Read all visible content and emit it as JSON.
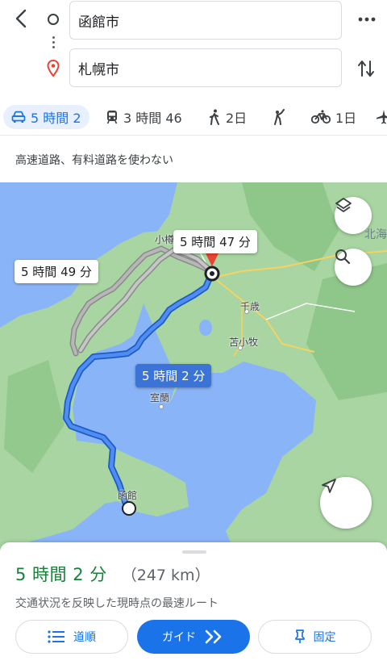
{
  "header": {
    "origin": "函館市",
    "destination": "札幌市"
  },
  "modes": [
    {
      "icon": "car-icon",
      "label": "5 時間 2",
      "active": true
    },
    {
      "icon": "train-icon",
      "label": "3 時間 46"
    },
    {
      "icon": "walk-icon",
      "label": "2日"
    },
    {
      "icon": "ride-icon",
      "label": ""
    },
    {
      "icon": "bike-icon",
      "label": "1日"
    },
    {
      "icon": "flight-icon",
      "label": ""
    }
  ],
  "options": "高速道路、有料道路を使わない",
  "map": {
    "route_labels": {
      "primary": "5 時間 2 分",
      "alt1": "5 時間 47 分",
      "alt2": "5 時間 49 分"
    },
    "places": {
      "otaru": "小樽",
      "chitose": "千歳",
      "tomakomai": "苫小牧",
      "muroran": "室蘭",
      "hakodate": "函館",
      "hokkai": "北海"
    },
    "colors": {
      "water": "#8ab4f8",
      "land": "#a8d5a2",
      "route": "#3b74d6",
      "alt_route": "#a3a3a3",
      "destination": "#ea4335"
    }
  },
  "sheet": {
    "duration": "5 時間 2 分",
    "distance": "（247 km）",
    "subtitle": "交通状況を反映した現時点の最速ルート",
    "steps_label": "道順",
    "guide_label": "ガイド",
    "pin_label": "固定"
  }
}
